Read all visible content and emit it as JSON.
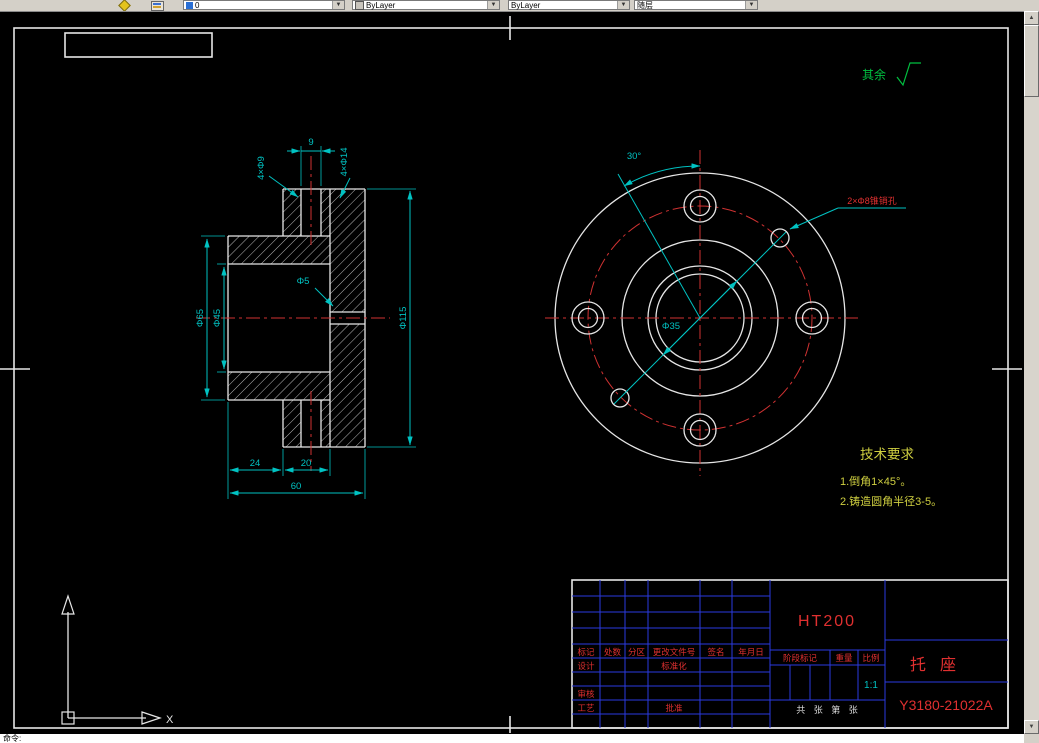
{
  "colors": {
    "background": "#000000",
    "drawing_line": "#e6e6e6",
    "dimension_cyan": "#00c2c2",
    "centerline_red": "#d03232",
    "note_green": "#00c040",
    "note_yellow": "#cfcf40",
    "title_grid_blue": "#2a3adf",
    "title_text_red": "#e03030",
    "toolbar_gray": "#d4d0c8"
  },
  "toolbar": {
    "combos": {
      "layer": "0",
      "color": "ByLayer",
      "linetype": "ByLayer",
      "lineweight": "随层"
    }
  },
  "statusbar": {
    "prompt": "命令:"
  },
  "notes": {
    "surface": "其余",
    "tech_title": "技术要求",
    "tech_items": [
      "1.倒角1×45°。",
      "2.铸造圆角半径3-5。"
    ],
    "pin_hole": "2×Φ8锥销孔"
  },
  "section_view": {
    "dims": {
      "slot": "9",
      "holes_small": "4×Φ9",
      "holes_large": "4×Φ14",
      "center_hole": "Φ5",
      "hub_od": "Φ65",
      "bore": "Φ45",
      "flange_od": "Φ115",
      "len_a": "24",
      "len_b": "20",
      "len_total": "60"
    }
  },
  "front_view": {
    "dims": {
      "angle": "30°",
      "bore": "Φ35"
    }
  },
  "title_block": {
    "rev_headers": [
      "标记",
      "处数",
      "分区",
      "更改文件号",
      "签名",
      "年月日"
    ],
    "labels": {
      "design": "设计",
      "standardization": "标准化",
      "audit": "审核",
      "process": "工艺",
      "approve": "批准",
      "stage": "阶段标记",
      "weight": "重量",
      "scale": "比例"
    },
    "values": {
      "material": "HT200",
      "part_name": "托座",
      "drawing_no": "Y3180-21022A",
      "scale": "1:1",
      "sheet": "共 张 第 张"
    }
  }
}
